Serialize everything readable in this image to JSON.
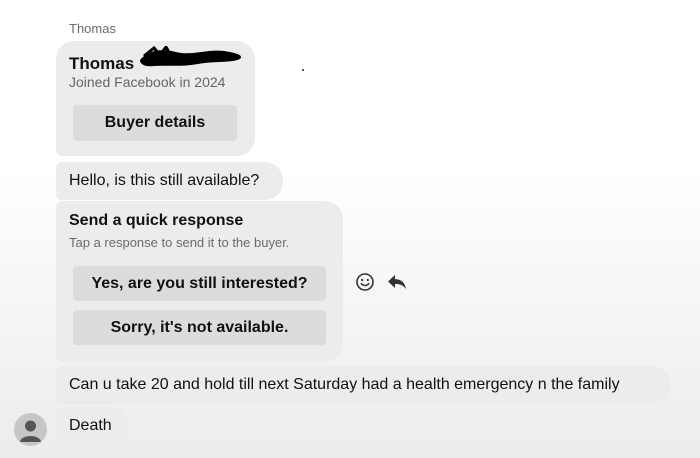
{
  "conversation": {
    "sender_name": "Thomas"
  },
  "profile_card": {
    "name": "Thomas",
    "joined": "Joined Facebook in 2024",
    "button_label": "Buyer details"
  },
  "messages": [
    {
      "text": "Hello, is this still available?"
    },
    {
      "text": "Can u take 20 and hold till next Saturday had a health emergency n the family"
    },
    {
      "text": "Death"
    }
  ],
  "quick_response": {
    "title": "Send a quick response",
    "subtitle": "Tap a response to send it to the buyer.",
    "options": [
      {
        "label": "Yes, are you still interested?"
      },
      {
        "label": "Sorry, it's not available."
      }
    ]
  },
  "hover_actions": {
    "icons": [
      "emoji-icon",
      "reply-icon"
    ]
  },
  "colors": {
    "bubble": "#ececec",
    "button": "#dcdcdc",
    "secondary_text": "#6b6b6b",
    "redaction": "#000000"
  }
}
